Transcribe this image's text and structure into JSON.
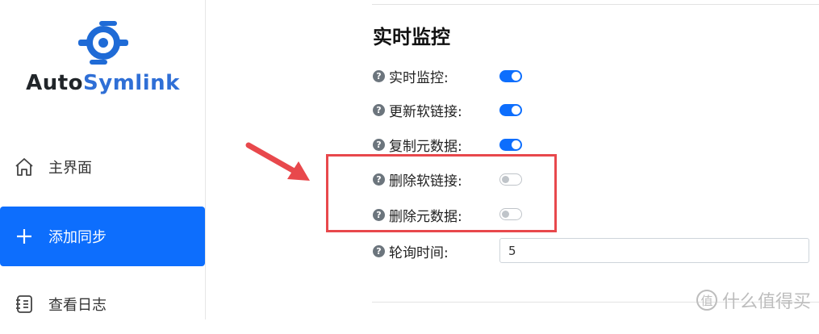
{
  "app": {
    "logo_part1": "Auto",
    "logo_part2": "Symlink",
    "accent_color": "#0d6efd"
  },
  "sidebar": {
    "items": [
      {
        "label": "主界面",
        "icon": "home-icon"
      },
      {
        "label": "添加同步",
        "icon": "plus-icon",
        "active": true
      },
      {
        "label": "查看日志",
        "icon": "log-icon"
      }
    ]
  },
  "monitor": {
    "title": "实时监控",
    "settings": [
      {
        "label": "实时监控:",
        "enabled": true
      },
      {
        "label": "更新软链接:",
        "enabled": true
      },
      {
        "label": "复制元数据:",
        "enabled": true
      },
      {
        "label": "删除软链接:",
        "enabled": false
      },
      {
        "label": "删除元数据:",
        "enabled": false
      }
    ],
    "poll": {
      "label": "轮询时间:",
      "value": "5"
    }
  },
  "watermark": {
    "text": "什么值得买",
    "logo": "值"
  }
}
